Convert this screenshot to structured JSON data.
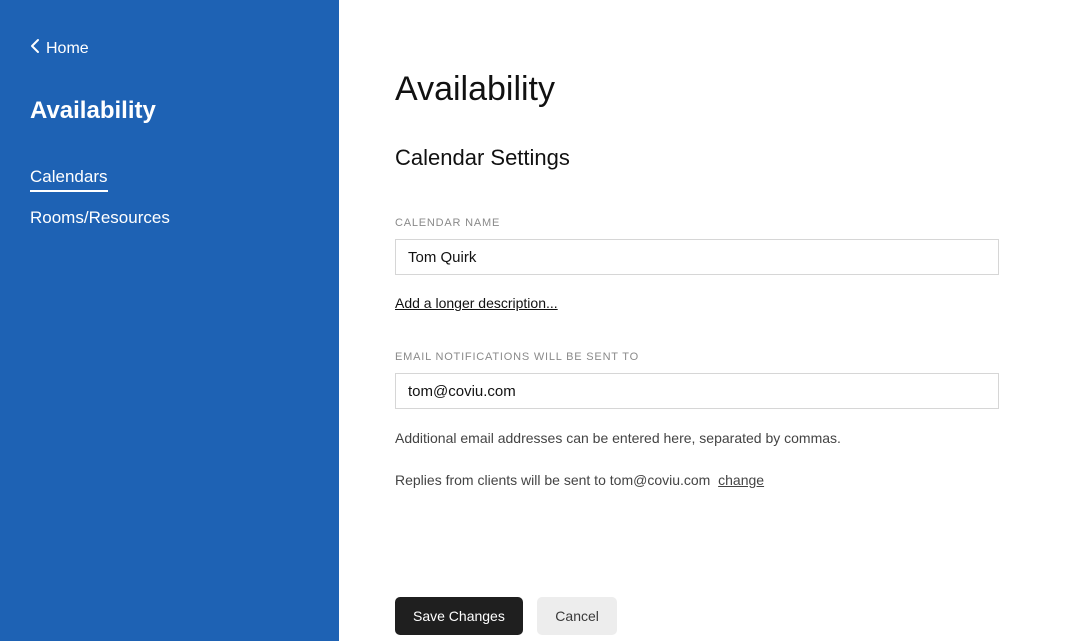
{
  "sidebar": {
    "home_label": "Home",
    "title": "Availability",
    "nav": [
      {
        "label": "Calendars",
        "active": true
      },
      {
        "label": "Rooms/Resources",
        "active": false
      }
    ]
  },
  "main": {
    "title": "Availability",
    "subtitle": "Calendar Settings",
    "calendar_name_label": "CALENDAR NAME",
    "calendar_name_value": "Tom Quirk",
    "add_description_label": "Add a longer description...",
    "email_label": "EMAIL NOTIFICATIONS WILL BE SENT TO",
    "email_value": "tom@coviu.com",
    "email_hint": "Additional email addresses can be entered here, separated by commas.",
    "reply_hint_prefix": "Replies from clients will be sent to ",
    "reply_email": "tom@coviu.com",
    "change_label": "change",
    "save_label": "Save Changes",
    "cancel_label": "Cancel"
  }
}
